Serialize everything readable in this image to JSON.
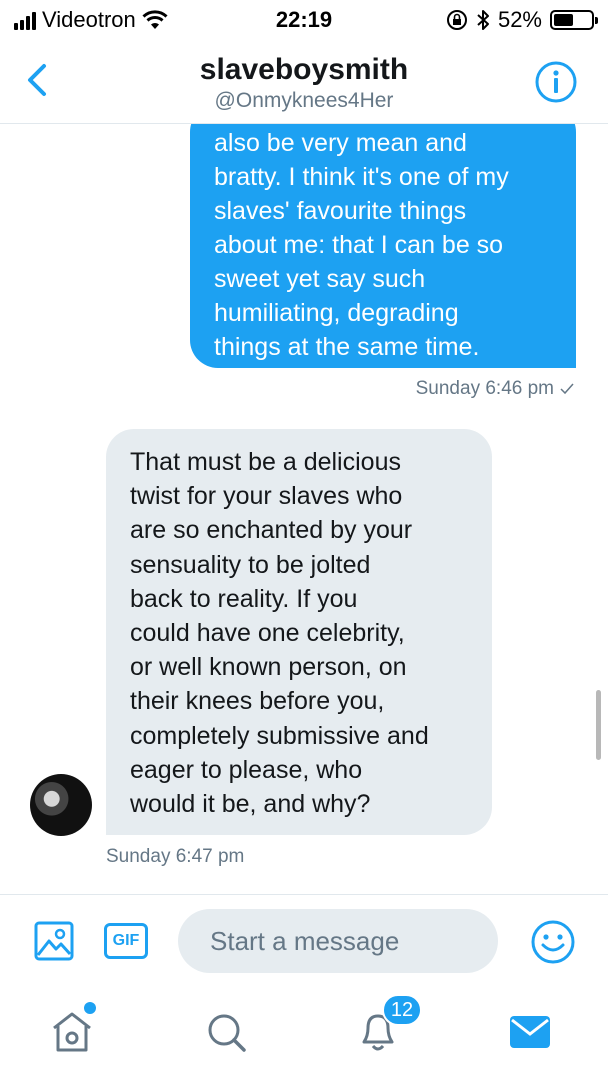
{
  "status_bar": {
    "carrier": "Videotron",
    "time": "22:19",
    "battery_percent": "52%",
    "battery_level": 0.52,
    "icons": [
      "signal-icon",
      "wifi-icon",
      "rotation-lock-icon",
      "bluetooth-icon",
      "battery-icon"
    ]
  },
  "header": {
    "title": "slaveboysmith",
    "handle": "@Onmyknees4Her",
    "back_icon": "chevron-left-icon",
    "info_icon": "info-icon"
  },
  "messages": [
    {
      "direction": "outgoing",
      "text": "also be very mean and\nbratty. I think it's one of my\nslaves' favourite things\nabout me: that I can be so\nsweet yet say such\nhumiliating, degrading\nthings at the same time.",
      "timestamp": "Sunday 6:46 pm",
      "status_icon": "check-icon"
    },
    {
      "direction": "incoming",
      "text": "That must be a delicious\ntwist for your slaves who\nare so enchanted by your\nsensuality to be jolted\nback to reality.  If you\ncould have one celebrity,\nor well known person, on\ntheir knees before you,\ncompletely submissive and\neager to please, who\nwould it be, and why?",
      "timestamp": "Sunday 6:47 pm"
    }
  ],
  "composer": {
    "placeholder": "Start a message",
    "gif_label": "GIF",
    "icons": [
      "image-icon",
      "gif-icon",
      "emoji-icon"
    ]
  },
  "tabbar": {
    "notification_count": "12",
    "icons": [
      "home-icon",
      "search-icon",
      "bell-icon",
      "mail-icon"
    ]
  },
  "colors": {
    "accent": "#1da1f2",
    "incoming_bubble": "#e6ecf0",
    "secondary_text": "#657786"
  }
}
